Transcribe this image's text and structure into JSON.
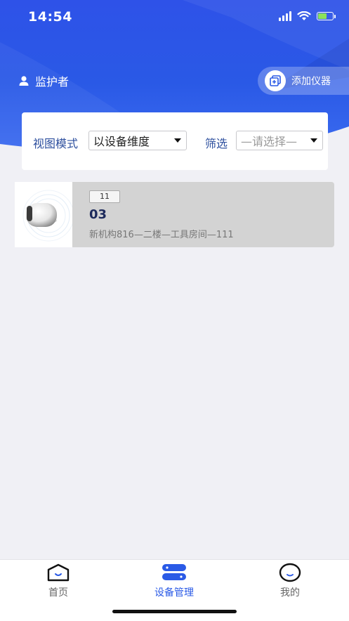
{
  "status_bar": {
    "time": "14:54",
    "signal_icon": "cellular-signal-icon",
    "wifi_icon": "wifi-icon",
    "battery_icon": "battery-charging-icon",
    "battery_level": 0.6
  },
  "header": {
    "user_icon": "person-icon",
    "user_role": "监护者",
    "add_button_icon": "add-device-icon",
    "add_button_label": "添加仪器",
    "gradient_colors": [
      "#2e52e8",
      "#3b6bf0"
    ]
  },
  "filters": {
    "view_mode_label": "视图模式",
    "view_mode_value": "以设备维度",
    "filter_label": "筛选",
    "filter_placeholder": "—请选择—"
  },
  "devices": [
    {
      "tag": "11",
      "name": "03",
      "location": "新机构816—二楼—工具房间—111",
      "image_icon": "device-puck-icon"
    }
  ],
  "tabbar": {
    "items": [
      {
        "label": "首页",
        "icon": "home-icon",
        "active": false
      },
      {
        "label": "设备管理",
        "icon": "device-management-icon",
        "active": true
      },
      {
        "label": "我的",
        "icon": "profile-icon",
        "active": false
      }
    ],
    "active_color": "#2a5ae6"
  }
}
